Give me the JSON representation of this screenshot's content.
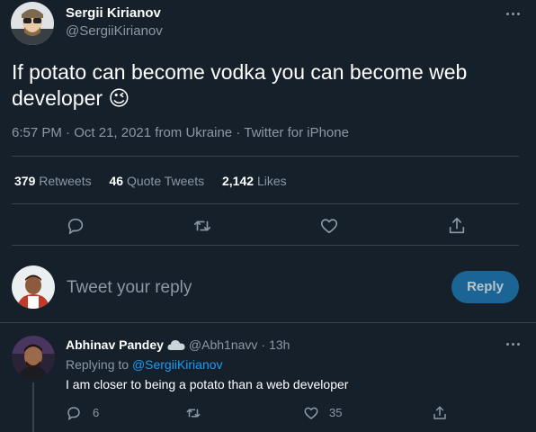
{
  "tweet": {
    "author_name": "Sergii Kirianov",
    "author_handle": "@SergiiKirianov",
    "text": "If potato can become vodka you can become web developer",
    "emoji": "😉",
    "time": "6:57 PM",
    "sep1": "·",
    "date": "Oct 21, 2021",
    "location": "from Ukraine",
    "sep2": "·",
    "source": "Twitter for iPhone",
    "icons": [
      "more-icon",
      "reply-icon",
      "retweet-icon",
      "like-icon",
      "share-icon"
    ]
  },
  "stats": {
    "retweets_count": "379",
    "retweets_label": "Retweets",
    "quotes_count": "46",
    "quotes_label": "Quote Tweets",
    "likes_count": "2,142",
    "likes_label": "Likes"
  },
  "composer": {
    "placeholder": "Tweet your reply",
    "reply_button": "Reply"
  },
  "reply": {
    "author_name": "Abhinav Pandey",
    "author_handle": "@Abh1navv",
    "sep": "·",
    "age": "13h",
    "replying_prefix": "Replying to",
    "replying_handle": "@SergiiKirianov",
    "text": "I am closer to being a potato than a web developer",
    "reply_count": "6",
    "like_count": "35",
    "badge_icon": "cloud-icon"
  },
  "colors": {
    "background": "#15202b",
    "accent": "#1d9bf0",
    "muted": "#8b98a5",
    "border": "#38444d"
  }
}
